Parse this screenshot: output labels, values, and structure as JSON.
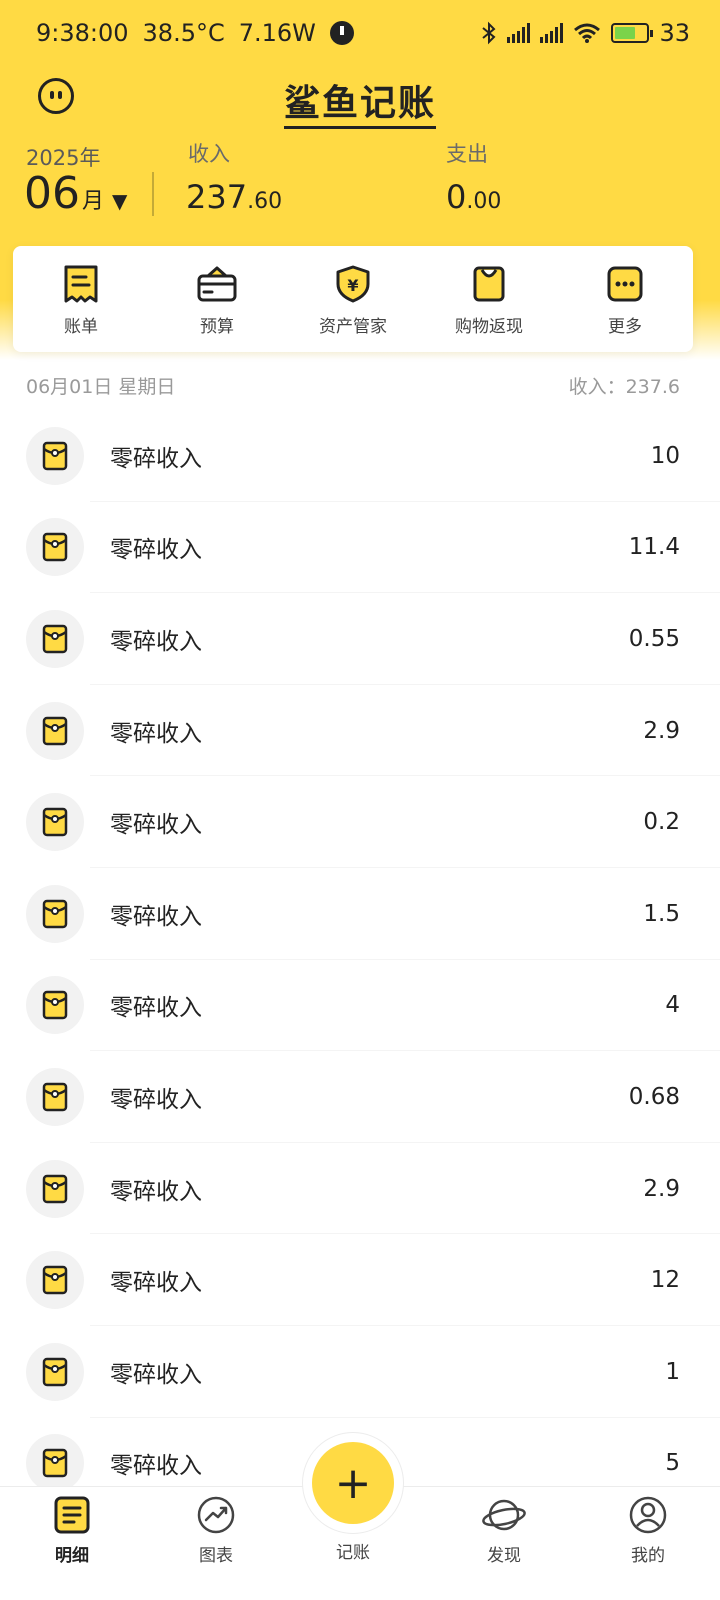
{
  "status_bar": {
    "time": "9:38:00",
    "temperature": "38.5°C",
    "power": "7.16W",
    "battery": "33"
  },
  "header": {
    "app_title": "鲨鱼记账",
    "year": "2025年",
    "month_number": "06",
    "month_unit": "月",
    "income_label": "收入",
    "income_int": "237",
    "income_dec": ".60",
    "expense_label": "支出",
    "expense_int": "0",
    "expense_dec": ".00"
  },
  "quick_actions": [
    {
      "label": "账单",
      "icon": "bill-icon"
    },
    {
      "label": "预算",
      "icon": "wallet-icon"
    },
    {
      "label": "资产管家",
      "icon": "shield-yen-icon"
    },
    {
      "label": "购物返现",
      "icon": "shopping-bag-icon"
    },
    {
      "label": "更多",
      "icon": "more-icon"
    }
  ],
  "day_group": {
    "date": "06月01日 星期日",
    "income_summary": "收入：237.6"
  },
  "transactions": [
    {
      "label": "零碎收入",
      "amount": "10"
    },
    {
      "label": "零碎收入",
      "amount": "11.4"
    },
    {
      "label": "零碎收入",
      "amount": "0.55"
    },
    {
      "label": "零碎收入",
      "amount": "2.9"
    },
    {
      "label": "零碎收入",
      "amount": "0.2"
    },
    {
      "label": "零碎收入",
      "amount": "1.5"
    },
    {
      "label": "零碎收入",
      "amount": "4"
    },
    {
      "label": "零碎收入",
      "amount": "0.68"
    },
    {
      "label": "零碎收入",
      "amount": "2.9"
    },
    {
      "label": "零碎收入",
      "amount": "12"
    },
    {
      "label": "零碎收入",
      "amount": "1"
    },
    {
      "label": "零碎收入",
      "amount": "5"
    }
  ],
  "tabbar": {
    "details": "明细",
    "charts": "图表",
    "add": "记账",
    "add_symbol": "+",
    "discover": "发现",
    "mine": "我的"
  },
  "colors": {
    "brand_yellow": "#FFDA44",
    "text_dark": "#222222"
  }
}
